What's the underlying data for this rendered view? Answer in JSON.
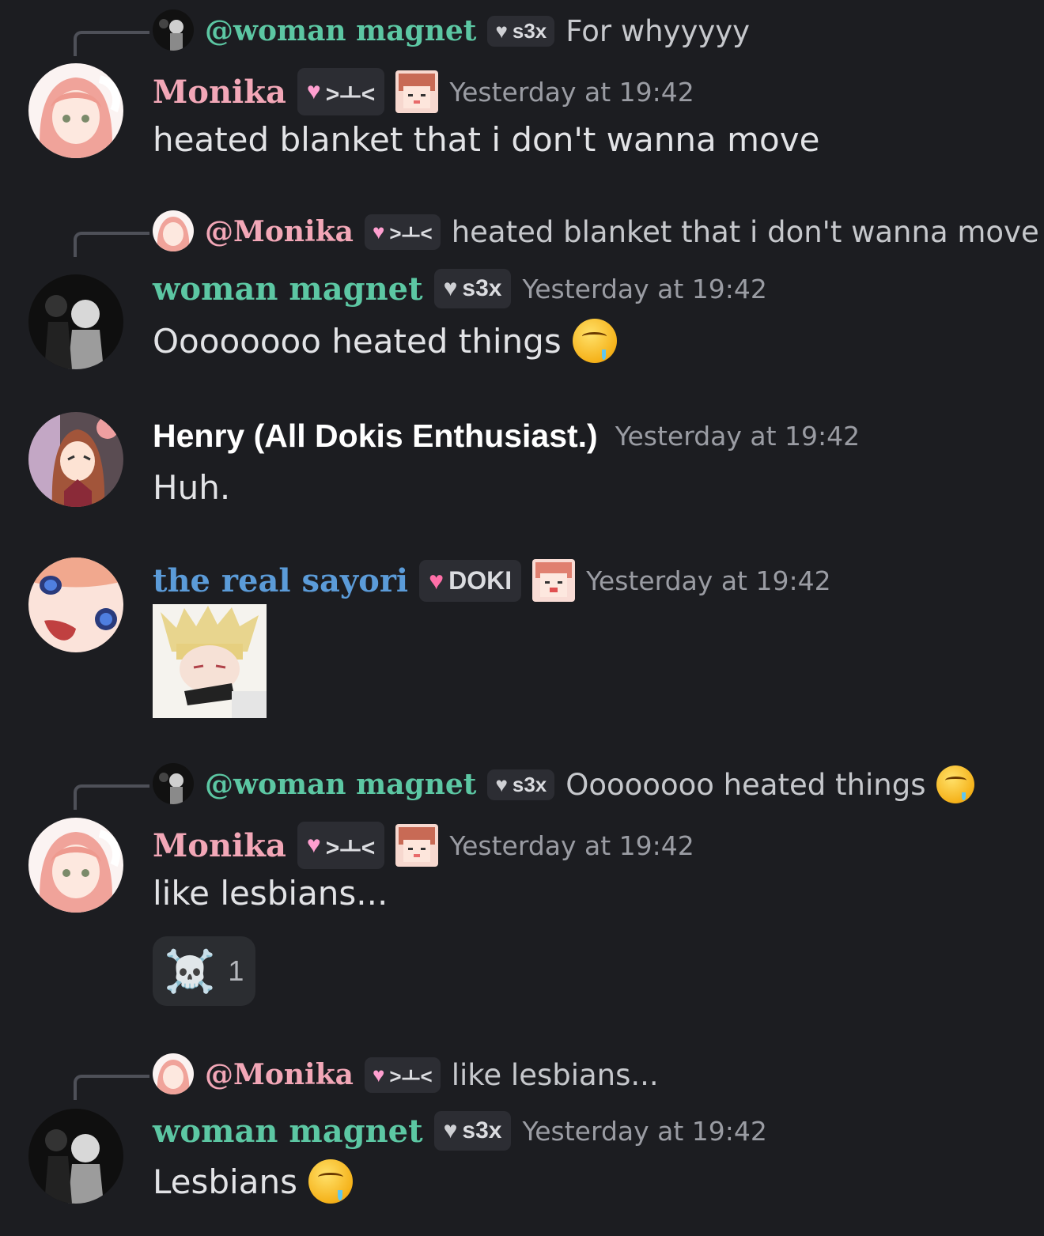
{
  "messages": [
    {
      "reply": {
        "name": "@woman magnet",
        "tag": "s3x",
        "text": "For whyyyyy"
      },
      "author": "Monika",
      "tag": ">ㅗ<",
      "time": "Yesterday at 19:42",
      "text": "heated blanket that i don't wanna move"
    },
    {
      "reply": {
        "name": "@Monika",
        "tag": ">ㅗ<",
        "text": "heated blanket that i don't wanna move"
      },
      "author": "woman magnet",
      "tag": "s3x",
      "time": "Yesterday at 19:42",
      "text": "Oooooooo heated things"
    },
    {
      "author": "Henry (All Dokis Enthusiast.)",
      "time": "Yesterday at 19:42",
      "text": "Huh."
    },
    {
      "author": "the real sayori",
      "tag": "DOKI",
      "time": "Yesterday at 19:42",
      "text": ""
    },
    {
      "reply": {
        "name": "@woman magnet",
        "tag": "s3x",
        "text": "Oooooooo heated things"
      },
      "author": "Monika",
      "tag": ">ㅗ<",
      "time": "Yesterday at 19:42",
      "text": "like lesbians...",
      "reaction": {
        "emoji": "☠️",
        "count": "1"
      }
    },
    {
      "reply": {
        "name": "@Monika",
        "tag": ">ㅗ<",
        "text": "like lesbians..."
      },
      "author": "woman magnet",
      "tag": "s3x",
      "time": "Yesterday at 19:42",
      "text": "Lesbians"
    }
  ],
  "colors": {
    "background": "#1c1d21",
    "monika": "#f2a7b7",
    "woman_magnet": "#5cc7a3",
    "henry": "#ffffff",
    "sayori": "#5b9bd8",
    "timestamp": "#9a9ca3"
  }
}
